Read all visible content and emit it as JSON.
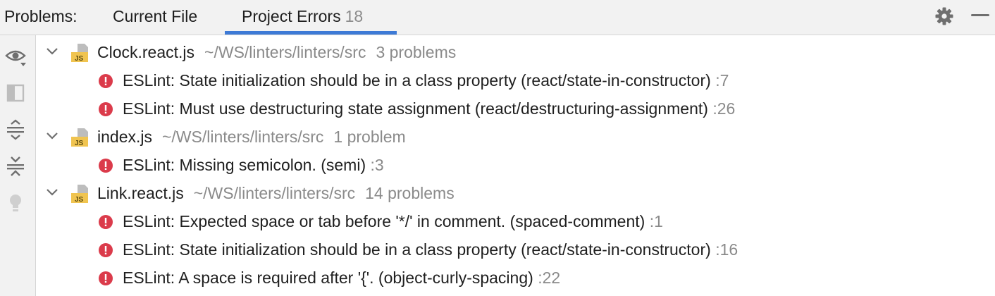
{
  "header": {
    "title": "Problems:",
    "tabs": [
      {
        "label": "Current File"
      },
      {
        "label": "Project Errors",
        "count": "18"
      }
    ],
    "active_tab": "Project Errors",
    "settings_icon": "gear-icon",
    "minimize_icon": "minimize-icon"
  },
  "toolbar": {
    "icons": [
      "eye-icon",
      "preview-panel-icon",
      "expand-all-icon",
      "collapse-all-icon",
      "lightbulb-icon"
    ]
  },
  "colors": {
    "accent": "#3d7ad6",
    "error": "#db3b4b",
    "js_file": "#f0c450"
  },
  "files": [
    {
      "name": "Clock.react.js",
      "path": "~/WS/linters/linters/src",
      "summary": "3 problems",
      "problems": [
        {
          "message": "ESLint: State initialization should be in a class property (react/state-in-constructor)",
          "line": ":7"
        },
        {
          "message": "ESLint: Must use destructuring state assignment (react/destructuring-assignment)",
          "line": ":26"
        }
      ]
    },
    {
      "name": "index.js",
      "path": "~/WS/linters/linters/src",
      "summary": "1 problem",
      "problems": [
        {
          "message": "ESLint: Missing semicolon. (semi)",
          "line": ":3"
        }
      ]
    },
    {
      "name": "Link.react.js",
      "path": "~/WS/linters/linters/src",
      "summary": "14 problems",
      "problems": [
        {
          "message": "ESLint: Expected space or tab before '*/' in comment. (spaced-comment)",
          "line": ":1"
        },
        {
          "message": "ESLint: State initialization should be in a class property (react/state-in-constructor)",
          "line": ":16"
        },
        {
          "message": "ESLint: A space is required after '{'. (object-curly-spacing)",
          "line": ":22"
        }
      ]
    }
  ]
}
